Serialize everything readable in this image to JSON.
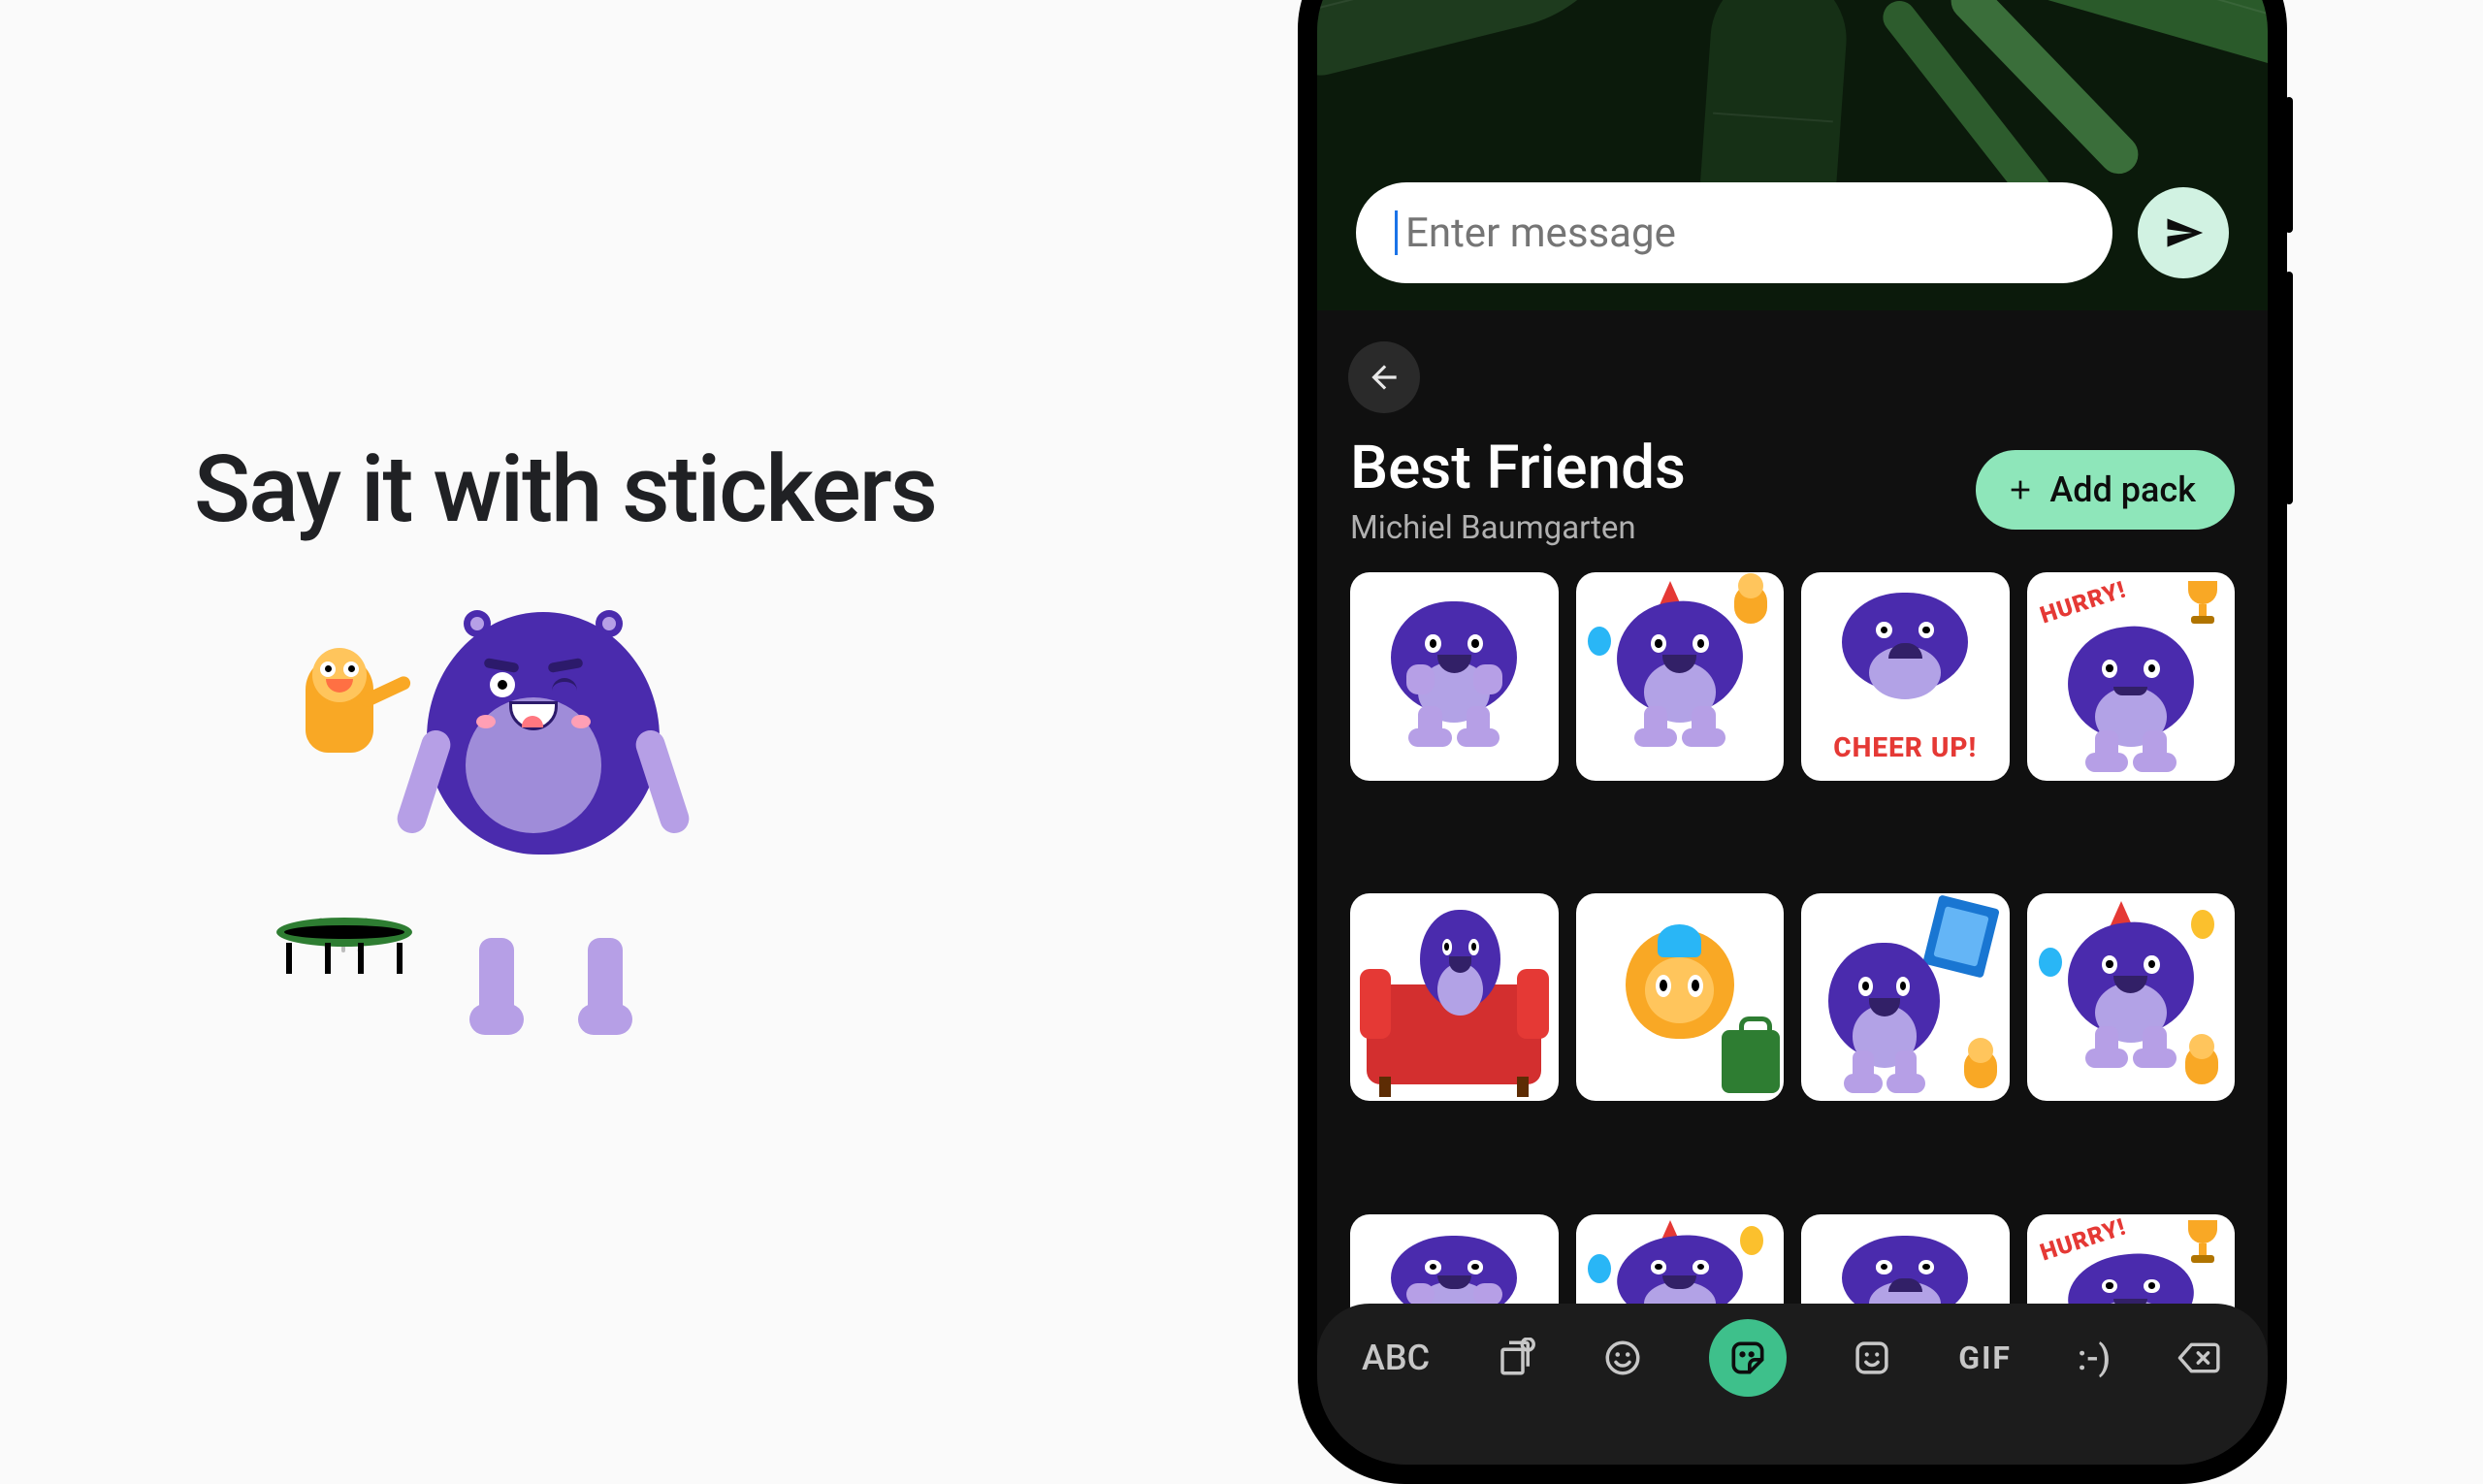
{
  "hero": {
    "headline": "Say it with stickers"
  },
  "compose": {
    "placeholder": "Enter message"
  },
  "pack": {
    "title": "Best Friends",
    "author": "Michiel Baumgarten",
    "add_label": "Add pack"
  },
  "stickers": {
    "row1": [
      {
        "name": "gasp",
        "text": ""
      },
      {
        "name": "party",
        "text": ""
      },
      {
        "name": "cheer-up",
        "text": "CHEER UP!"
      },
      {
        "name": "hurry",
        "text": "HURRY!"
      }
    ],
    "row2": [
      {
        "name": "couch",
        "text": ""
      },
      {
        "name": "travel",
        "text": ""
      },
      {
        "name": "breakfast",
        "text": ""
      },
      {
        "name": "celebrate",
        "text": ""
      }
    ],
    "row3": [
      {
        "name": "gasp",
        "text": ""
      },
      {
        "name": "party",
        "text": ""
      },
      {
        "name": "tired",
        "text": ""
      },
      {
        "name": "hurry",
        "text": "HURRY!"
      }
    ]
  },
  "keyboard": {
    "abc": "ABC",
    "gif": "GIF",
    "smiley": ":-)"
  }
}
